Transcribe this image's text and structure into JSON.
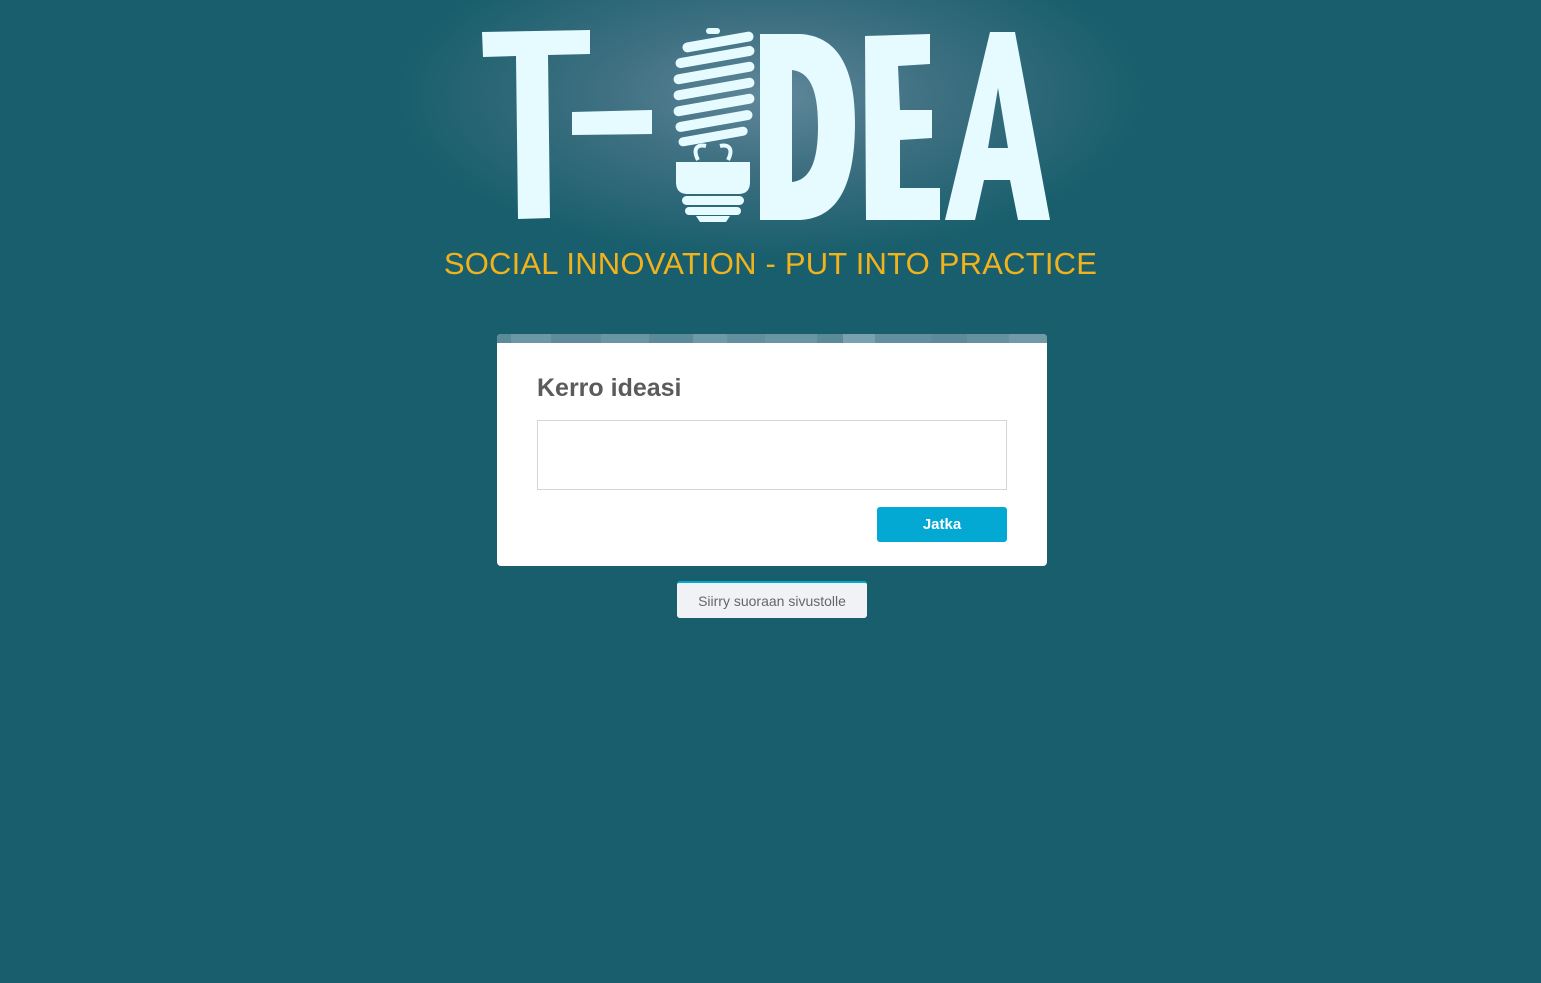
{
  "logo": {
    "text": "T-IDEA",
    "icon": "lightbulb-icon"
  },
  "tagline": "SOCIAL INNOVATION - PUT INTO PRACTICE",
  "card": {
    "title": "Kerro ideasi",
    "input_value": "",
    "submit_label": "Jatka"
  },
  "skip_label": "Siirry suoraan sivustolle",
  "colors": {
    "background": "#185e6c",
    "tagline": "#f2b21b",
    "logo_text": "#e6fbff",
    "primary_button": "#03a9d3",
    "card": "#ffffff",
    "title_text": "#5b5b5b",
    "secondary_button": "#f1f2f6"
  }
}
